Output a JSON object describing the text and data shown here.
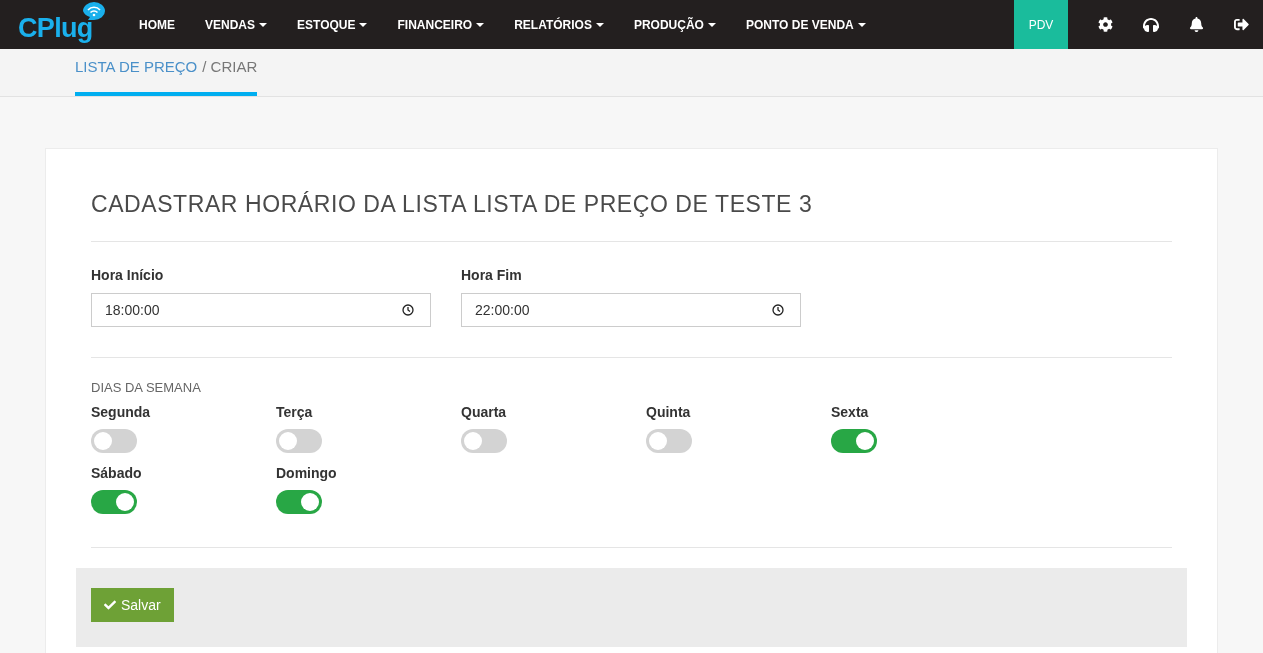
{
  "logo": "CPlug",
  "nav": [
    {
      "label": "HOME",
      "dropdown": false
    },
    {
      "label": "VENDAS",
      "dropdown": true
    },
    {
      "label": "ESTOQUE",
      "dropdown": true
    },
    {
      "label": "FINANCEIRO",
      "dropdown": true
    },
    {
      "label": "RELATÓRIOS",
      "dropdown": true
    },
    {
      "label": "PRODUÇÃO",
      "dropdown": true
    },
    {
      "label": "PONTO DE VENDA",
      "dropdown": true
    }
  ],
  "pdv": "PDV",
  "breadcrumb": {
    "link": "LISTA DE PREÇO",
    "current": "/ CRIAR"
  },
  "form": {
    "title": "CADASTRAR HORÁRIO DA LISTA LISTA DE PREÇO DE TESTE 3",
    "fields": [
      {
        "label": "Hora Início",
        "value": "18:00:00"
      },
      {
        "label": "Hora Fim",
        "value": "22:00:00"
      }
    ],
    "days_title": "DIAS DA SEMANA",
    "days": [
      {
        "label": "Segunda",
        "on": false
      },
      {
        "label": "Terça",
        "on": false
      },
      {
        "label": "Quarta",
        "on": false
      },
      {
        "label": "Quinta",
        "on": false
      },
      {
        "label": "Sexta",
        "on": true
      },
      {
        "label": "Sábado",
        "on": true
      },
      {
        "label": "Domingo",
        "on": true
      }
    ],
    "save": "Salvar"
  }
}
